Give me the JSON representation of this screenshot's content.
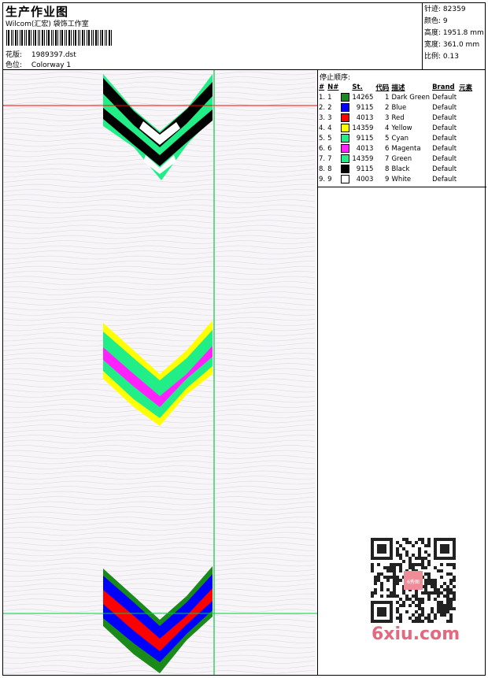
{
  "header": {
    "title": "生产作业图",
    "studio": "Wilcom(汇宏) 袋饰工作室",
    "file_label": "花版:",
    "file_value": "1989397.dst",
    "colorway_label": "色位:",
    "colorway_value": "Colorway 1"
  },
  "stats": [
    {
      "label": "针迹:",
      "value": "82359"
    },
    {
      "label": "颜色:",
      "value": "9"
    },
    {
      "label": "高度:",
      "value": "1951.8 mm"
    },
    {
      "label": "宽度:",
      "value": "361.0 mm"
    },
    {
      "label": "比例:",
      "value": "0.13"
    }
  ],
  "sequence": {
    "title": "停止顺序:",
    "headers": [
      "#",
      "N#",
      "St.",
      "代码",
      "描述",
      "Brand",
      "元素"
    ],
    "rows": [
      {
        "idx": "1.",
        "n": "1",
        "color": "#1a8a1a",
        "st": "14265",
        "code": "1",
        "desc": "Dark Green",
        "brand": "Default"
      },
      {
        "idx": "2.",
        "n": "2",
        "color": "#0000ff",
        "st": "9115",
        "code": "2",
        "desc": "Blue",
        "brand": "Default"
      },
      {
        "idx": "3.",
        "n": "3",
        "color": "#ff0000",
        "st": "4013",
        "code": "3",
        "desc": "Red",
        "brand": "Default"
      },
      {
        "idx": "4.",
        "n": "4",
        "color": "#ffff00",
        "st": "14359",
        "code": "4",
        "desc": "Yellow",
        "brand": "Default"
      },
      {
        "idx": "5.",
        "n": "5",
        "color": "#22ee88",
        "st": "9115",
        "code": "5",
        "desc": "Cyan",
        "brand": "Default"
      },
      {
        "idx": "6.",
        "n": "6",
        "color": "#ff22ff",
        "st": "4013",
        "code": "6",
        "desc": "Magenta",
        "brand": "Default"
      },
      {
        "idx": "7.",
        "n": "7",
        "color": "#22ee88",
        "st": "14359",
        "code": "7",
        "desc": "Green",
        "brand": "Default"
      },
      {
        "idx": "8.",
        "n": "8",
        "color": "#000000",
        "st": "9115",
        "code": "8",
        "desc": "Black",
        "brand": "Default"
      },
      {
        "idx": "9.",
        "n": "9",
        "color": "#ffffff",
        "st": "4003",
        "code": "9",
        "desc": "White",
        "brand": "Default"
      }
    ]
  },
  "watermark": {
    "text": "6xiu.com",
    "qr_badge": "6秀图"
  },
  "colors": {
    "guide_red": "#ff0000",
    "guide_green": "#00cc44",
    "canvas_bg": "#f7f5f8"
  }
}
